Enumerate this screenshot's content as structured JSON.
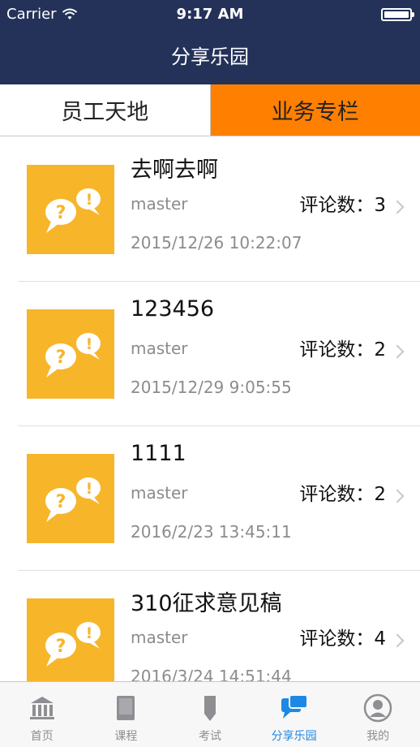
{
  "status_bar": {
    "carrier": "Carrier",
    "time": "9:17 AM"
  },
  "nav": {
    "title": "分享乐园"
  },
  "segments": [
    {
      "label": "员工天地",
      "selected": false
    },
    {
      "label": "业务专栏",
      "selected": true
    }
  ],
  "posts": [
    {
      "title": "去啊去啊",
      "author": "master",
      "comments_label": "评论数：",
      "comments": "3",
      "date": "2015/12/26 10:22:07"
    },
    {
      "title": "123456",
      "author": "master",
      "comments_label": "评论数：",
      "comments": "2",
      "date": "2015/12/29 9:05:55"
    },
    {
      "title": "1111",
      "author": "master",
      "comments_label": "评论数：",
      "comments": "2",
      "date": "2016/2/23 13:45:11"
    },
    {
      "title": "310征求意见稿",
      "author": "master",
      "comments_label": "评论数：",
      "comments": "4",
      "date": "2016/3/24 14:51:44"
    }
  ],
  "tabs": [
    {
      "label": "首页",
      "icon": "bank-icon",
      "active": false
    },
    {
      "label": "课程",
      "icon": "book-icon",
      "active": false
    },
    {
      "label": "考试",
      "icon": "pencil-icon",
      "active": false
    },
    {
      "label": "分享乐园",
      "icon": "chat-bubbles-icon",
      "active": true
    },
    {
      "label": "我的",
      "icon": "person-icon",
      "active": false
    }
  ],
  "colors": {
    "nav_bg": "#243259",
    "selected_segment": "#ff8000",
    "thumb_bg": "#f7b52a",
    "tab_active": "#1e88e5"
  }
}
